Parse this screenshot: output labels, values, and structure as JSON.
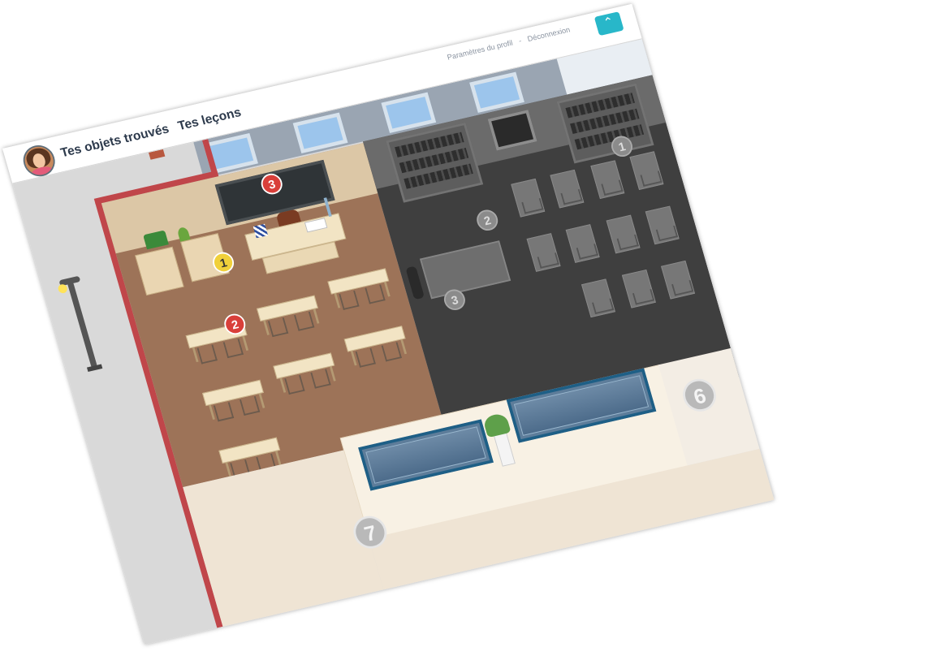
{
  "header": {
    "nav": [
      "Tes objets trouvés",
      "Tes leçons"
    ],
    "links": {
      "profile": "Paramètres du profil",
      "separator": "-",
      "logout": "Déconnexion"
    },
    "up_button": "⌃"
  },
  "map": {
    "badges": {
      "board": "3",
      "desk_row": "2",
      "drawer": "1",
      "dark_shelf": "1",
      "dark_desks": "2",
      "dark_chair": "3",
      "room_6": "6",
      "room_7": "7"
    }
  },
  "colors": {
    "accent_button": "#28b7c9",
    "red_wall": "#c0464a",
    "classroom_floor": "#9d7358",
    "locked_room": "#3f3f3f",
    "vitrine_frame": "#1e5f86"
  }
}
